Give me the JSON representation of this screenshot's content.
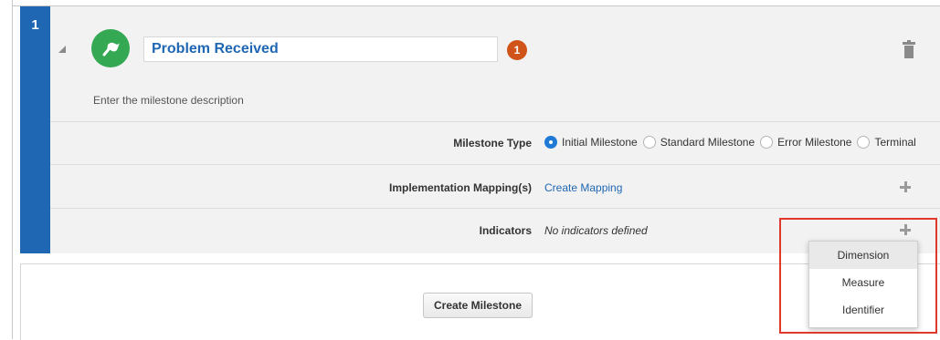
{
  "milestone": {
    "number": "1",
    "name_value": "Problem Received",
    "badge_count": "1",
    "description": "Enter the milestone description"
  },
  "milestone_type": {
    "label": "Milestone Type",
    "options": [
      {
        "label": "Initial Milestone",
        "selected": true
      },
      {
        "label": "Standard Milestone",
        "selected": false
      },
      {
        "label": "Error Milestone",
        "selected": false
      },
      {
        "label": "Terminal",
        "selected": false
      }
    ]
  },
  "implementation_mapping": {
    "label": "Implementation Mapping(s)",
    "link": "Create Mapping"
  },
  "indicators": {
    "label": "Indicators",
    "empty_text": "No indicators defined"
  },
  "add_menu": {
    "items": [
      "Dimension",
      "Measure",
      "Identifier"
    ],
    "highlighted": "Dimension"
  },
  "create_button": "Create Milestone",
  "colors": {
    "accent_blue": "#1f67b3",
    "icon_green": "#34a853",
    "badge_orange": "#d0531a",
    "highlight_red": "#e0382b"
  },
  "icons": [
    "collapse-triangle-icon",
    "milestone-flag-icon",
    "trash-icon",
    "plus-icon"
  ]
}
